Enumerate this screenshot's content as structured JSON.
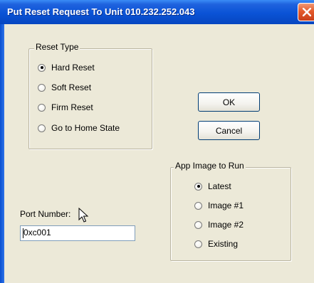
{
  "window": {
    "title": "Put Reset Request To Unit 010.232.252.043"
  },
  "reset_type": {
    "title": "Reset Type",
    "options": [
      {
        "label": "Hard Reset",
        "checked": true
      },
      {
        "label": "Soft Reset",
        "checked": false
      },
      {
        "label": "Firm Reset",
        "checked": false
      },
      {
        "label": "Go to Home State",
        "checked": false
      }
    ]
  },
  "buttons": {
    "ok": "OK",
    "cancel": "Cancel"
  },
  "app_image": {
    "title": "App Image to Run",
    "options": [
      {
        "label": "Latest",
        "checked": true
      },
      {
        "label": "Image #1",
        "checked": false
      },
      {
        "label": "Image #2",
        "checked": false
      },
      {
        "label": "Existing",
        "checked": false
      }
    ]
  },
  "port": {
    "label": "Port Number:",
    "value": "0xc001"
  },
  "icons": {
    "close": "close-icon",
    "pointer": "mouse-pointer-icon"
  },
  "colors": {
    "title_bar": "#0a53d6",
    "close_button": "#e45a2b",
    "dialog_bg": "#ece9d8"
  }
}
